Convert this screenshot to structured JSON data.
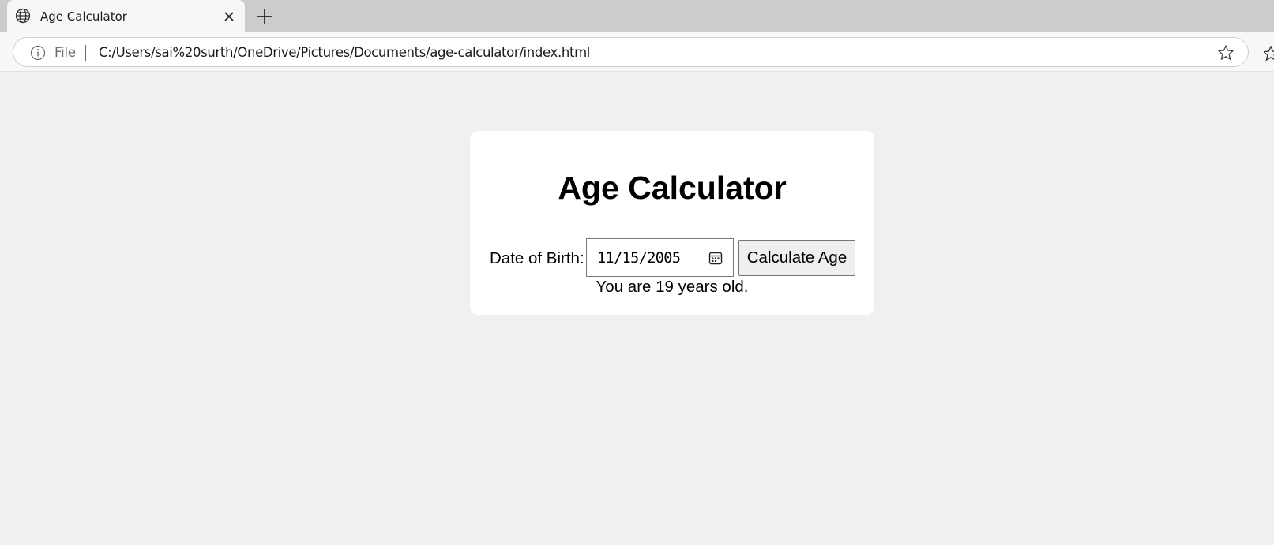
{
  "browser": {
    "tab": {
      "title": "Age Calculator",
      "icon": "globe-icon"
    },
    "address_bar": {
      "scheme_label": "File",
      "url": "C:/Users/sai%20surth/OneDrive/Pictures/Documents/age-calculator/index.html"
    },
    "icons": [
      "globe-icon",
      "close-icon",
      "plus-icon",
      "info-icon",
      "star-icon"
    ]
  },
  "page": {
    "title": "Age Calculator",
    "form": {
      "dob_label": "Date of Birth:",
      "dob_value": "11/15/2005",
      "calculate_button": "Calculate Age"
    },
    "result": "You are 19 years old."
  },
  "colors": {
    "page_background": "#f0f0f0",
    "card_background": "#ffffff",
    "tabstrip": "#cccccc",
    "button_background": "#efefef"
  }
}
